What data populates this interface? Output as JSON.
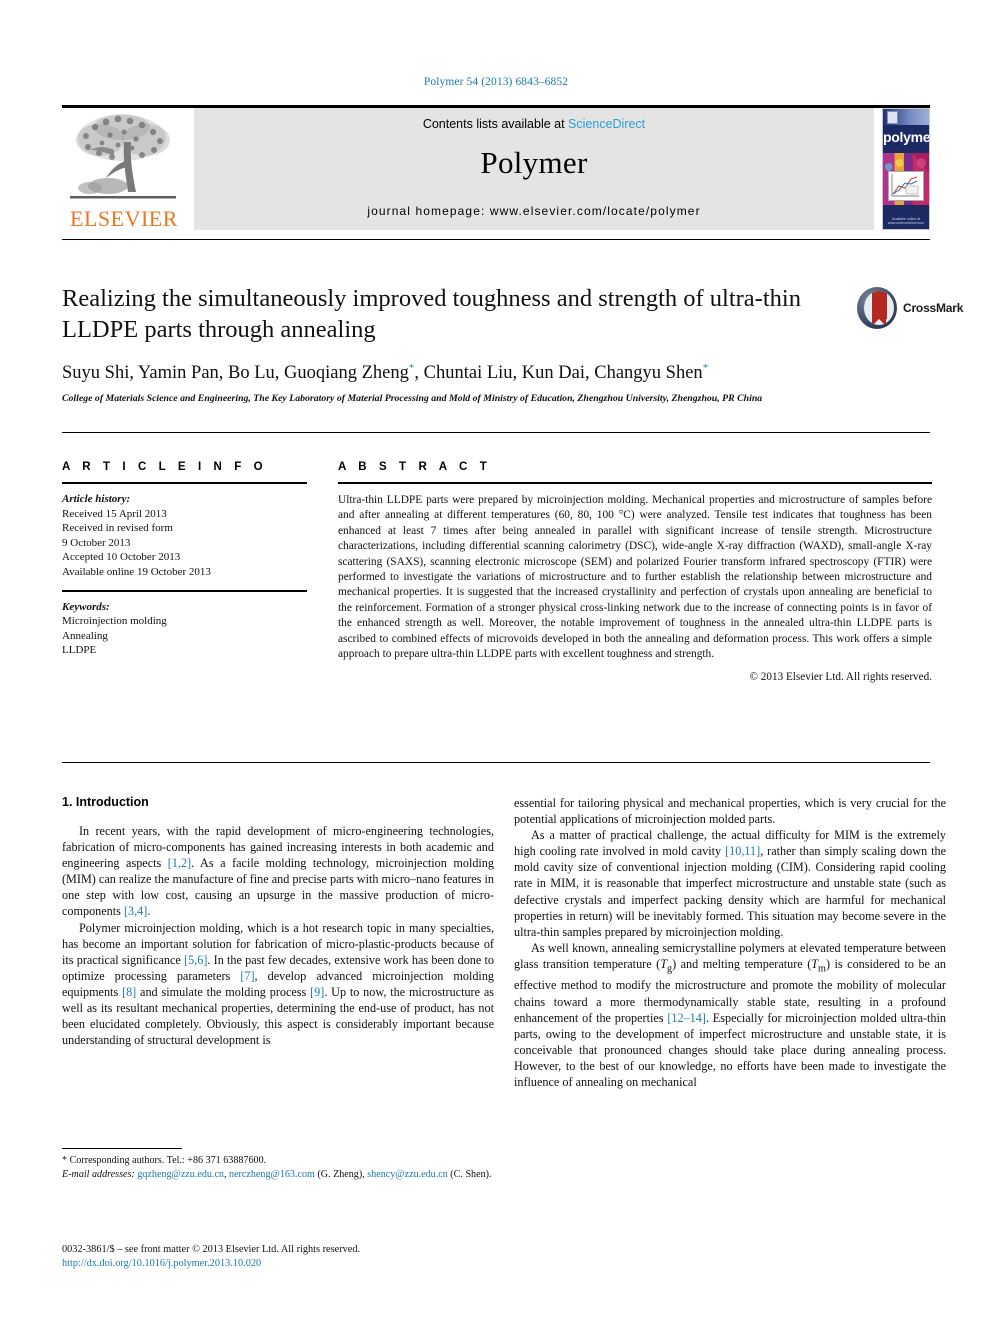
{
  "journal_ref": "Polymer 54 (2013) 6843–6852",
  "header": {
    "contents_prefix": "Contents lists available at ",
    "sciencedirect": "ScienceDirect",
    "journal_name": "Polymer",
    "homepage": "journal homepage: www.elsevier.com/locate/polymer",
    "publisher": "ELSEVIER",
    "cover_title": "polymer",
    "cover_footer": "Available online at www.sciencedirect.com"
  },
  "article": {
    "title": "Realizing the simultaneously improved toughness and strength of ultra-thin LLDPE parts through annealing",
    "crossmark_label": "CrossMark",
    "authors_html": "Suyu Shi, Yamin Pan, Bo Lu, Guoqiang Zheng<sup>*</sup>, Chuntai Liu, Kun Dai, Changyu Shen<sup>*</sup>",
    "affiliation": "College of Materials Science and Engineering, The Key Laboratory of Material Processing and Mold of Ministry of Education, Zhengzhou University, Zhengzhou, PR China"
  },
  "info": {
    "heading": "A R T I C L E   I N F O",
    "history_label": "Article history:",
    "history": [
      "Received 15 April 2013",
      "Received in revised form",
      "9 October 2013",
      "Accepted 10 October 2013",
      "Available online 19 October 2013"
    ],
    "keywords_label": "Keywords:",
    "keywords": [
      "Microinjection molding",
      "Annealing",
      "LLDPE"
    ]
  },
  "abstract": {
    "heading": "A B S T R A C T",
    "text": "Ultra-thin LLDPE parts were prepared by microinjection molding. Mechanical properties and microstructure of samples before and after annealing at different temperatures (60, 80, 100 °C) were analyzed. Tensile test indicates that toughness has been enhanced at least 7 times after being annealed in parallel with significant increase of tensile strength. Microstructure characterizations, including differential scanning calorimetry (DSC), wide-angle X-ray diffraction (WAXD), small-angle X-ray scattering (SAXS), scanning electronic microscope (SEM) and polarized Fourier transform infrared spectroscopy (FTIR) were performed to investigate the variations of microstructure and to further establish the relationship between microstructure and mechanical properties. It is suggested that the increased crystallinity and perfection of crystals upon annealing are beneficial to the reinforcement. Formation of a stronger physical cross-linking network due to the increase of connecting points is in favor of the enhanced strength as well. Moreover, the notable improvement of toughness in the annealed ultra-thin LLDPE parts is ascribed to combined effects of microvoids developed in both the annealing and deformation process. This work offers a simple approach to prepare ultra-thin LLDPE parts with excellent toughness and strength.",
    "copyright": "© 2013 Elsevier Ltd. All rights reserved."
  },
  "body": {
    "section_heading": "1. Introduction",
    "left_paragraphs": [
      "In recent years, with the rapid development of micro-engineering technologies, fabrication of micro-components has gained increasing interests in both academic and engineering aspects [1,2]. As a facile molding technology, microinjection molding (MIM) can realize the manufacture of fine and precise parts with micro–nano features in one step with low cost, causing an upsurge in the massive production of micro-components [3,4].",
      "Polymer microinjection molding, which is a hot research topic in many specialties, has become an important solution for fabrication of micro-plastic-products because of its practical significance [5,6]. In the past few decades, extensive work has been done to optimize processing parameters [7], develop advanced microinjection molding equipments [8] and simulate the molding process [9]. Up to now, the microstructure as well as its resultant mechanical properties, determining the end-use of product, has not been elucidated completely. Obviously, this aspect is considerably important because understanding of structural development is"
    ],
    "right_paragraphs": [
      "essential for tailoring physical and mechanical properties, which is very crucial for the potential applications of microinjection molded parts.",
      "As a matter of practical challenge, the actual difficulty for MIM is the extremely high cooling rate involved in mold cavity [10,11], rather than simply scaling down the mold cavity size of conventional injection molding (CIM). Considering rapid cooling rate in MIM, it is reasonable that imperfect microstructure and unstable state (such as defective crystals and imperfect packing density which are harmful for mechanical properties in return) will be inevitably formed. This situation may become severe in the ultra-thin samples prepared by microinjection molding.",
      "As well known, annealing semicrystalline polymers at elevated temperature between glass transition temperature (Tg) and melting temperature (Tm) is considered to be an effective method to modify the microstructure and promote the mobility of molecular chains toward a more thermodynamically stable state, resulting in a profound enhancement of the properties [12–14]. Especially for microinjection molded ultra-thin parts, owing to the development of imperfect microstructure and unstable state, it is conceivable that pronounced changes should take place during annealing process. However, to the best of our knowledge, no efforts have been made to investigate the influence of annealing on mechanical"
    ]
  },
  "footnote": {
    "corresponding": "* Corresponding authors. Tel.: +86 371 63887600.",
    "email_label": "E-mail addresses:",
    "email1": "gqzheng@zzu.edu.cn",
    "email2": "nerczheng@163.com",
    "email1_attr": "(G. Zheng),",
    "email3": "shency@zzu.edu.cn",
    "email3_attr": "(C. Shen)."
  },
  "footer": {
    "issn_line": "0032-3861/$ – see front matter © 2013 Elsevier Ltd. All rights reserved.",
    "doi": "http://dx.doi.org/10.1016/j.polymer.2013.10.020"
  }
}
